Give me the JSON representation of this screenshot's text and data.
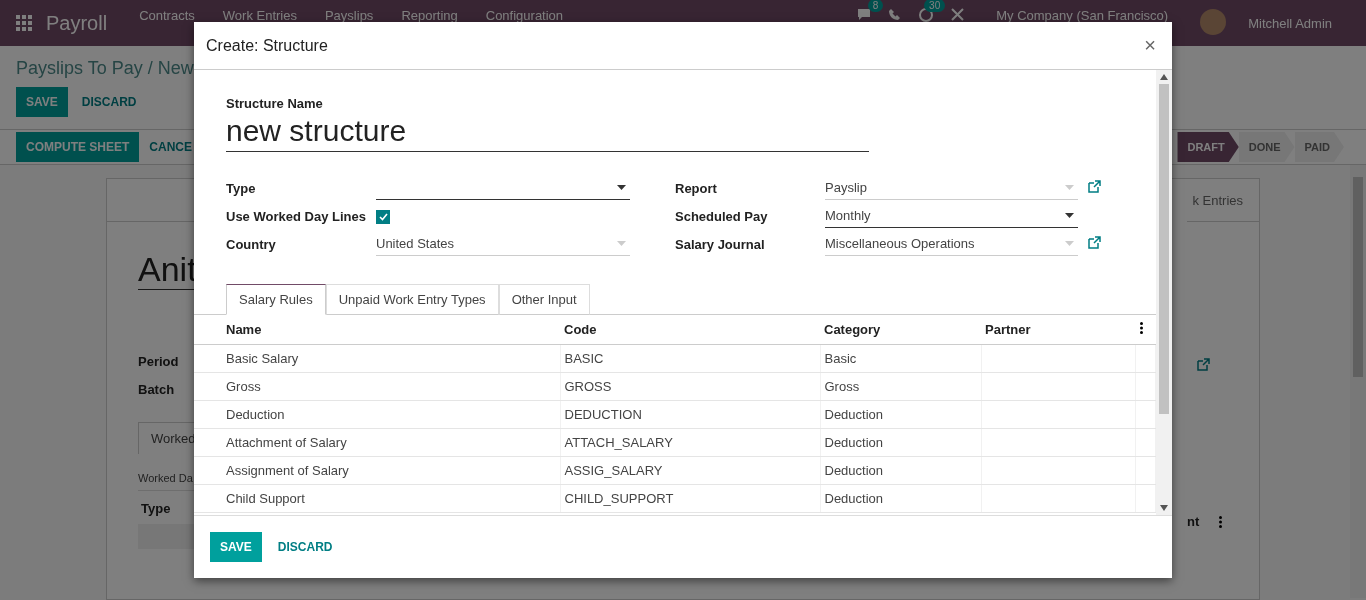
{
  "navbar": {
    "app_name": "Payroll",
    "menu": [
      "Contracts",
      "Work Entries",
      "Payslips",
      "Reporting",
      "Configuration"
    ],
    "chat_count": "8",
    "activity_count": "30",
    "company": "My Company (San Francisco)",
    "user": "Mitchell Admin"
  },
  "control_panel": {
    "breadcrumb": "Payslips To Pay / New",
    "buttons": [
      "SAVE",
      "DISCARD"
    ],
    "actions": [
      "COMPUTE SHEET",
      "CANCE"
    ],
    "stages": [
      {
        "label": "DRAFT",
        "selected": true
      },
      {
        "label": "DONE",
        "selected": false
      },
      {
        "label": "PAID",
        "selected": false
      }
    ]
  },
  "sheet": {
    "smart_button": "k Entries",
    "name": "Anit",
    "fields": [
      "Period",
      "Batch"
    ],
    "tab": "Worked",
    "section_label": "Worked Da",
    "columns": [
      "Type",
      "nt"
    ]
  },
  "dialog": {
    "title": "Create: Structure",
    "close": "×",
    "name_label": "Structure Name",
    "name_value": "new structure",
    "fields_left": [
      {
        "label": "Type",
        "kind": "select"
      },
      {
        "label": "Use Worked Day Lines",
        "kind": "checkbox",
        "checked": true
      },
      {
        "label": "Country",
        "kind": "many2one",
        "value": "United States"
      }
    ],
    "fields_right": [
      {
        "label": "Report",
        "kind": "many2one",
        "value": "Payslip",
        "link": true
      },
      {
        "label": "Scheduled Pay",
        "kind": "select",
        "value": "Monthly"
      },
      {
        "label": "Salary Journal",
        "kind": "many2one",
        "value": "Miscellaneous Operations",
        "link": true
      }
    ],
    "tabs": [
      {
        "label": "Salary Rules",
        "selected": true
      },
      {
        "label": "Unpaid Work Entry Types",
        "selected": false
      },
      {
        "label": "Other Input",
        "selected": false
      }
    ],
    "columns": [
      "Name",
      "Code",
      "Category",
      "Partner"
    ],
    "rows": [
      {
        "name": "Basic Salary",
        "code": "BASIC",
        "category": "Basic"
      },
      {
        "name": "Gross",
        "code": "GROSS",
        "category": "Gross"
      },
      {
        "name": "Deduction",
        "code": "DEDUCTION",
        "category": "Deduction"
      },
      {
        "name": "Attachment of Salary",
        "code": "ATTACH_SALARY",
        "category": "Deduction"
      },
      {
        "name": "Assignment of Salary",
        "code": "ASSIG_SALARY",
        "category": "Deduction"
      },
      {
        "name": "Child Support",
        "code": "CHILD_SUPPORT",
        "category": "Deduction"
      }
    ],
    "footer_buttons": [
      "SAVE",
      "DISCARD"
    ]
  }
}
